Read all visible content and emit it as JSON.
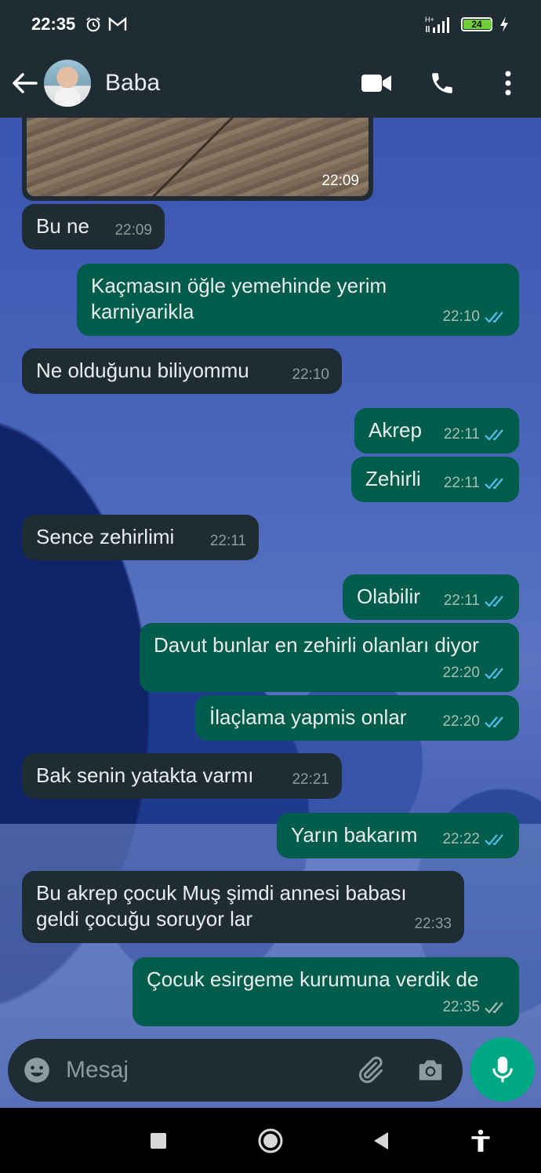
{
  "status_bar": {
    "time": "22:35",
    "battery": "24",
    "battery_level": 0.24,
    "icons": [
      "alarm-icon",
      "gmail-icon",
      "signal-icon",
      "battery-icon",
      "charging-icon"
    ]
  },
  "header": {
    "contact_name": "Baba",
    "icons": [
      "back-arrow-icon",
      "video-call-icon",
      "phone-icon",
      "more-vert-icon"
    ]
  },
  "image_message": {
    "time": "22:09"
  },
  "messages": [
    {
      "dir": "in",
      "text": "Bu ne",
      "time": "22:09"
    },
    {
      "dir": "out",
      "text": "Kaçmasın öğle yemehinde yerim karniyarikla",
      "time": "22:10"
    },
    {
      "dir": "in",
      "text": "Ne olduğunu biliyommu",
      "time": "22:10"
    },
    {
      "dir": "out",
      "text": "Akrep",
      "time": "22:11"
    },
    {
      "dir": "out",
      "text": "Zehirli",
      "time": "22:11"
    },
    {
      "dir": "in",
      "text": "Sence zehirlimi",
      "time": "22:11"
    },
    {
      "dir": "out",
      "text": "Olabilir",
      "time": "22:11"
    },
    {
      "dir": "out",
      "text": "Davut bunlar en zehirli olanları diyor",
      "time": "22:20"
    },
    {
      "dir": "out",
      "text": "İlaçlama yapmis onlar",
      "time": "22:20"
    },
    {
      "dir": "in",
      "text": "Bak senin yatakta varmı",
      "time": "22:21"
    },
    {
      "dir": "out",
      "text": "Yarın bakarım",
      "time": "22:22"
    },
    {
      "dir": "in",
      "text": "Bu akrep çocuk Muş şimdi annesi babası geldi çocuğu soruyor lar",
      "time": "22:33"
    },
    {
      "dir": "out",
      "text": "Çocuk esirgeme kurumuna verdik de",
      "time": "22:35"
    }
  ],
  "composer": {
    "placeholder": "Mesaj",
    "icons": [
      "emoji-icon",
      "attach-icon",
      "camera-icon",
      "mic-icon"
    ]
  },
  "colors": {
    "incoming_bubble": "#1f2c34",
    "outgoing_bubble": "#005c4b",
    "read_ticks": "#53bdeb",
    "accent": "#00a884"
  }
}
